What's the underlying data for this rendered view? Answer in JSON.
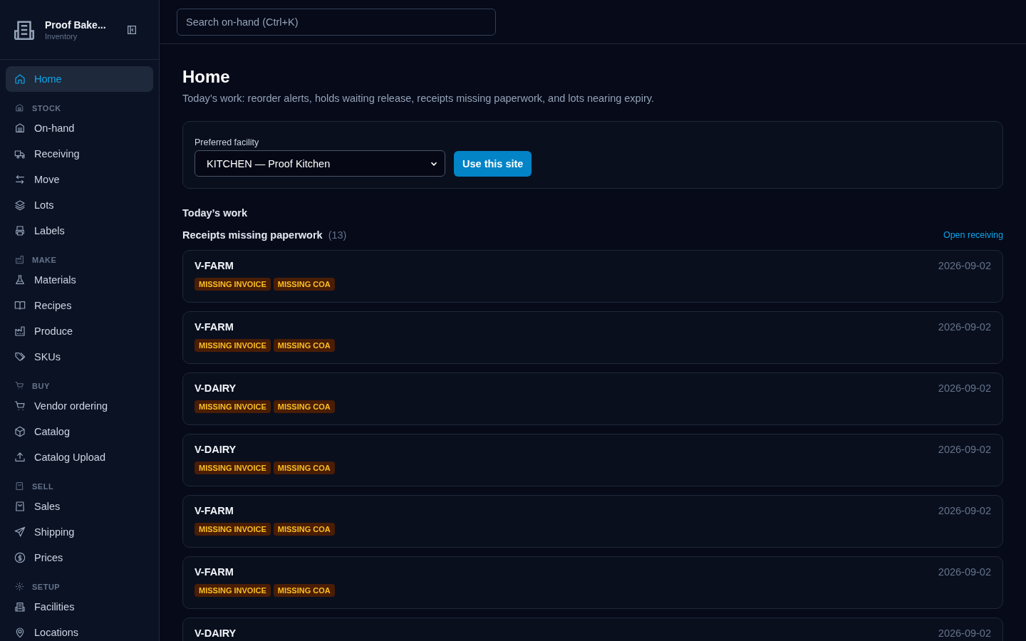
{
  "brand": {
    "name": "Proof Bake...",
    "subtitle": "Inventory"
  },
  "home": {
    "label": "Home",
    "selected": true
  },
  "sections": [
    {
      "title": "STOCK",
      "items": [
        {
          "label": "On-hand",
          "selected": false
        },
        {
          "label": "Receiving",
          "selected": false
        },
        {
          "label": "Move",
          "selected": false
        },
        {
          "label": "Lots",
          "selected": false
        },
        {
          "label": "Labels",
          "selected": false
        }
      ]
    },
    {
      "title": "MAKE",
      "items": [
        {
          "label": "Materials",
          "selected": false
        },
        {
          "label": "Recipes",
          "selected": false
        },
        {
          "label": "Produce",
          "selected": false
        },
        {
          "label": "SKUs",
          "selected": false
        }
      ]
    },
    {
      "title": "BUY",
      "items": [
        {
          "label": "Vendor ordering",
          "selected": false
        },
        {
          "label": "Catalog",
          "selected": false
        },
        {
          "label": "Catalog Upload",
          "selected": false
        }
      ]
    },
    {
      "title": "SELL",
      "items": [
        {
          "label": "Sales",
          "selected": false
        },
        {
          "label": "Shipping",
          "selected": false
        },
        {
          "label": "Prices",
          "selected": false
        }
      ]
    },
    {
      "title": "SETUP",
      "items": [
        {
          "label": "Facilities",
          "selected": false
        },
        {
          "label": "Locations",
          "selected": false
        }
      ]
    }
  ],
  "search": {
    "placeholder": "Search on-hand (Ctrl+K)"
  },
  "page": {
    "title": "Home",
    "description": "Today’s work: reorder alerts, holds waiting release, receipts missing paperwork, and lots nearing expiry."
  },
  "facility": {
    "label": "Preferred facility",
    "value": "KITCHEN — Proof Kitchen",
    "button": "Use this site"
  },
  "work_title": "Today’s work",
  "receipts": {
    "title": "Receipts missing paperwork",
    "count": "(13)",
    "link": "Open receiving",
    "items": [
      {
        "vendor": "V-FARM",
        "date": "2026-09-02",
        "tags": [
          "MISSING INVOICE",
          "MISSING COA"
        ]
      },
      {
        "vendor": "V-FARM",
        "date": "2026-09-02",
        "tags": [
          "MISSING INVOICE",
          "MISSING COA"
        ]
      },
      {
        "vendor": "V-DAIRY",
        "date": "2026-09-02",
        "tags": [
          "MISSING INVOICE",
          "MISSING COA"
        ]
      },
      {
        "vendor": "V-DAIRY",
        "date": "2026-09-02",
        "tags": [
          "MISSING INVOICE",
          "MISSING COA"
        ]
      },
      {
        "vendor": "V-FARM",
        "date": "2026-09-02",
        "tags": [
          "MISSING INVOICE",
          "MISSING COA"
        ]
      },
      {
        "vendor": "V-FARM",
        "date": "2026-09-02",
        "tags": [
          "MISSING INVOICE",
          "MISSING COA"
        ]
      },
      {
        "vendor": "V-DAIRY",
        "date": "2026-09-02"
      }
    ]
  }
}
